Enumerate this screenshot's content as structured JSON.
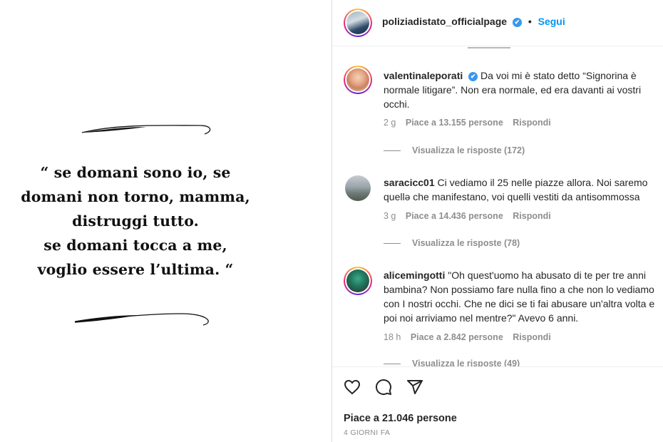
{
  "quote": {
    "lines": [
      "“ se domani sono io, se",
      "domani non torno, mamma,",
      "distruggi tutto.",
      "se domani tocca a me,",
      "voglio essere l’ultima. “"
    ]
  },
  "header": {
    "username": "poliziadistato_officialpage",
    "verified_icon": "✔",
    "dot": "•",
    "follow_label": "Segui"
  },
  "comments": [
    {
      "username": "valentinaleporati",
      "verified_icon": "✔",
      "lines": [
        "Da voi mi è stato detto “Signorina è",
        "normale litigare”. Non era normale, ed era davanti ai vostri",
        "occhi."
      ],
      "time": "2 g",
      "likes": "Piace a 13.155 persone",
      "reply_label": "Rispondi",
      "view_replies": "Visualizza le risposte (172)"
    },
    {
      "username": "saracicc01",
      "lines": [
        "Ci vediamo il 25 nelle piazze allora. Noi saremo",
        "quellə che manifestano, voi quelli vestiti da antisommossa"
      ],
      "time": "3 g",
      "likes": "Piace a 14.436 persone",
      "reply_label": "Rispondi",
      "view_replies": "Visualizza le risposte (78)"
    },
    {
      "username": "alicemingotti",
      "lines": [
        "\"Oh quest'uomo ha abusato di te per tre anni",
        "bambina? Non possiamo fare nulla fino a che non lo vediamo",
        "con I nostri occhi. Che ne dici se ti fai abusare un'altra volta e",
        "poi noi arriviamo nel mentre?\" Avevo 6 anni."
      ],
      "time": "18 h",
      "likes": "Piace a 2.842 persone",
      "reply_label": "Rispondi",
      "view_replies": "Visualizza le risposte (49)"
    }
  ],
  "footer": {
    "like_icon": "heart-icon",
    "comment_icon": "comment-icon",
    "share_icon": "share-icon",
    "likes": "Piace a 21.046 persone",
    "time": "4 GIORNI FA"
  },
  "colors": {
    "link": "#0095f6",
    "verified": "#3897f0",
    "muted": "#8e8e8e",
    "text": "#262626"
  }
}
